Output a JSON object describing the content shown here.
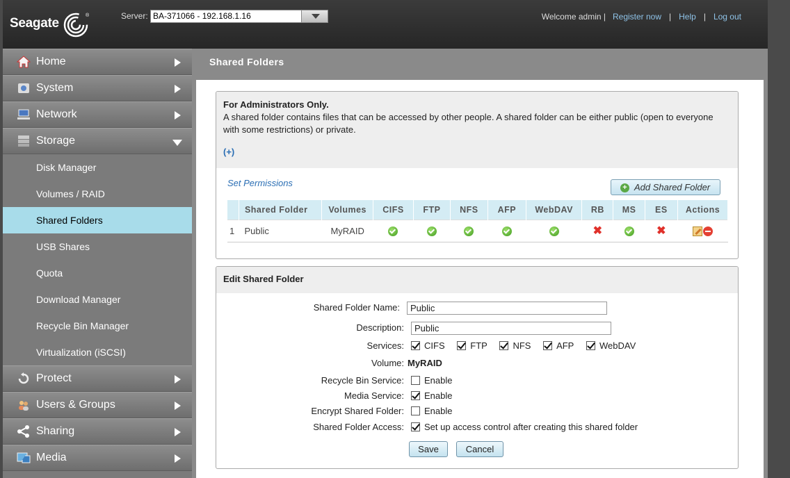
{
  "header": {
    "brand": "Seagate",
    "server_label": "Server:",
    "server_value": "BA-371066 - 192.168.1.16",
    "welcome": "Welcome admin |",
    "register": "Register now",
    "sep1": "|",
    "help": "Help",
    "sep2": "|",
    "logout": "Log out"
  },
  "sidebar": {
    "main_top": [
      {
        "label": "Home",
        "icon": "home-icon"
      },
      {
        "label": "System",
        "icon": "system-icon"
      },
      {
        "label": "Network",
        "icon": "network-icon"
      },
      {
        "label": "Storage",
        "icon": "storage-icon"
      }
    ],
    "sub": [
      {
        "label": "Disk Manager"
      },
      {
        "label": "Volumes / RAID"
      },
      {
        "label": "Shared Folders"
      },
      {
        "label": "USB Shares"
      },
      {
        "label": "Quota"
      },
      {
        "label": "Download Manager"
      },
      {
        "label": "Recycle Bin Manager"
      },
      {
        "label": "Virtualization (iSCSI)"
      }
    ],
    "main_bottom": [
      {
        "label": "Protect",
        "icon": "protect-icon"
      },
      {
        "label": "Users & Groups",
        "icon": "users-icon"
      },
      {
        "label": "Sharing",
        "icon": "sharing-icon"
      },
      {
        "label": "Media",
        "icon": "media-icon"
      }
    ]
  },
  "page": {
    "title": "Shared Folders"
  },
  "admin_box": {
    "heading": "For Administrators Only.",
    "description": "A shared folder contains files that can be accessed by other people. A shared folder can be either public (open to everyone with some restrictions) or private.",
    "expand": "(+)",
    "set_permissions": "Set Permissions",
    "add_button": "Add Shared Folder"
  },
  "table": {
    "columns": [
      "Shared Folder",
      "Volumes",
      "CIFS",
      "FTP",
      "NFS",
      "AFP",
      "WebDAV",
      "RB",
      "MS",
      "ES",
      "Actions"
    ],
    "rows": [
      {
        "index": "1",
        "name": "Public",
        "volume": "MyRAID",
        "cifs": "ok",
        "ftp": "ok",
        "nfs": "ok",
        "afp": "ok",
        "webdav": "ok",
        "rb": "no",
        "ms": "ok",
        "es": "no"
      }
    ]
  },
  "edit": {
    "heading": "Edit Shared Folder",
    "name_label": "Shared Folder Name:",
    "name_value": "Public",
    "desc_label": "Description:",
    "desc_value": "Public",
    "services_label": "Services:",
    "services": [
      {
        "label": "CIFS",
        "checked": true
      },
      {
        "label": "FTP",
        "checked": true
      },
      {
        "label": "NFS",
        "checked": true
      },
      {
        "label": "AFP",
        "checked": true
      },
      {
        "label": "WebDAV",
        "checked": true
      }
    ],
    "volume_label": "Volume:",
    "volume_value": "MyRAID",
    "recycle_label": "Recycle Bin Service:",
    "recycle_text": "Enable",
    "media_label": "Media Service:",
    "media_text": "Enable",
    "encrypt_label": "Encrypt Shared Folder:",
    "encrypt_text": "Enable",
    "access_label": "Shared Folder Access:",
    "access_text": "Set up access control after creating this shared folder",
    "save": "Save",
    "cancel": "Cancel"
  }
}
